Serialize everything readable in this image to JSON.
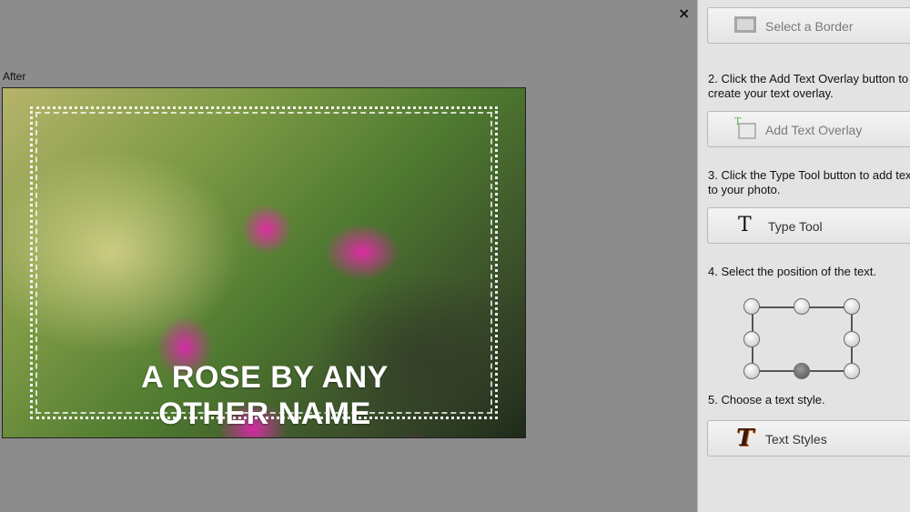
{
  "canvas": {
    "after_label": "After",
    "close_symbol": "×",
    "overlay_lines": [
      "A ROSE BY ANY",
      "OTHER NAME"
    ]
  },
  "panel": {
    "select_border_label": "Select a Border",
    "step2_text": "2. Click the Add Text Overlay button to create your text overlay.",
    "add_text_overlay_label": "Add Text Overlay",
    "step3_text": "3. Click the Type Tool button to add text to your photo.",
    "type_tool_label": "Type Tool",
    "type_tool_glyph": "T",
    "step4_text": "4. Select the position of the text.",
    "position_selected": "bottom-center",
    "step5_text": "5. Choose a text style.",
    "text_styles_label": "Text Styles",
    "text_styles_glyph": "T"
  },
  "icons": {
    "close": "close-icon",
    "border": "border-icon",
    "overlay": "text-overlay-icon",
    "type": "type-tool-icon",
    "styles": "text-styles-icon"
  },
  "colors": {
    "canvas_bg": "#8c8c8c",
    "panel_bg": "#e3e3e3",
    "overlay_text": "#ffffff"
  }
}
